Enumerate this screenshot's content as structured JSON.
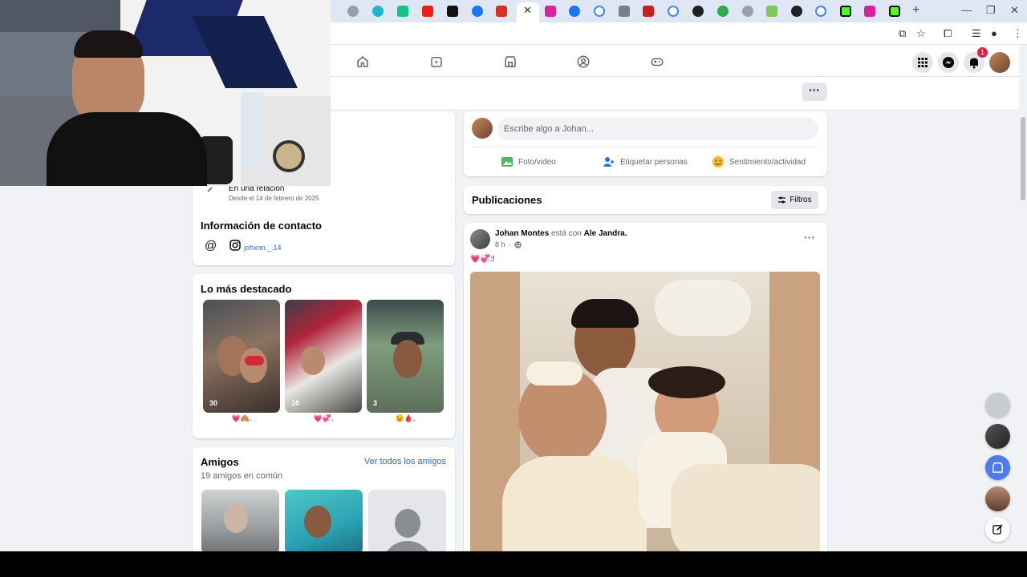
{
  "composer": {
    "placeholder": "Escribe algo a Johan...",
    "photo_label": "Foto/video",
    "tag_label": "Etiquetar personas",
    "feeling_label": "Sentimiento/actividad"
  },
  "posts_header": {
    "title": "Publicaciones",
    "filters_label": "Filtros"
  },
  "post": {
    "author": "Johan Montes",
    "with_text": "está con",
    "tagged": "Ale Jandra.",
    "time": "8 h",
    "text": "💗💞:!"
  },
  "intro": {
    "relationship": "En una relación",
    "relationship_since": "Desde el 14 de febrero de 2025"
  },
  "contact": {
    "title": "Información de contacto",
    "instagram": "johxnn._.14"
  },
  "highlights": {
    "title": "Lo más destacado",
    "items": [
      {
        "count": "30",
        "caption": "💗🙈."
      },
      {
        "count": "10",
        "caption": "💗💞."
      },
      {
        "count": "3",
        "caption": "😉🩸."
      }
    ]
  },
  "friends": {
    "title": "Amigos",
    "see_all": "Ver todos los amigos",
    "mutual": "19 amigos en común"
  },
  "notifications": {
    "count": "1"
  },
  "colors": {
    "fb_blue": "#0866ff",
    "link_blue": "#216fdb",
    "page_bg": "#f0f2f5",
    "badge_red": "#e41e3f"
  },
  "icons": [
    "home-icon",
    "watch-icon",
    "marketplace-icon",
    "groups-icon",
    "gaming-icon",
    "menu-grid-icon",
    "messenger-icon",
    "bell-icon",
    "more-icon",
    "photo-icon",
    "tag-icon",
    "feeling-icon",
    "filter-icon",
    "instagram-icon",
    "at-icon",
    "relationship-icon",
    "globe-icon",
    "edit-icon"
  ]
}
